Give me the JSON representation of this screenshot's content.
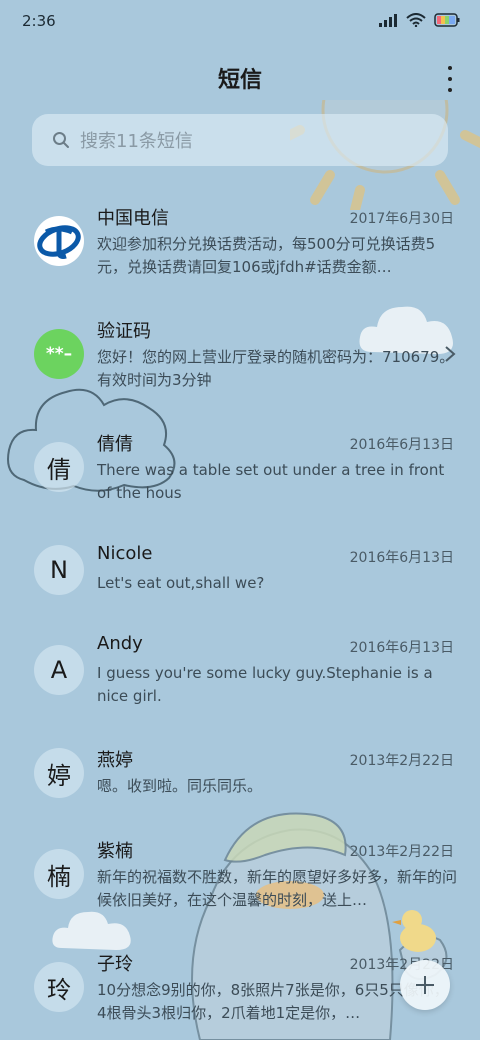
{
  "status": {
    "time": "2:36",
    "icons": [
      "signal-icon",
      "wifi-icon",
      "battery-icon"
    ]
  },
  "header": {
    "title": "短信",
    "menu_icon": "more-vertical-icon"
  },
  "search": {
    "placeholder": "搜索11条短信",
    "icon": "search-icon"
  },
  "messages": [
    {
      "avatar": "",
      "avatar_type": "china-telecom-logo",
      "sender": "中国电信",
      "date": "2017年6月30日",
      "preview": "欢迎参加积分兑换话费活动，每500分可兑换话费5元，兑换话费请回复106或jfdh#话费金额…"
    },
    {
      "avatar": "**–",
      "avatar_type": "code",
      "sender": "验证码",
      "date": "",
      "preview": "您好！您的网上营业厅登录的随机密码为：710679。有效时间为3分钟"
    },
    {
      "avatar": "倩",
      "sender": "倩倩",
      "date": "2016年6月13日",
      "preview": "There was a table set out under a tree in front of the hous"
    },
    {
      "avatar": "N",
      "sender": "Nicole",
      "date": "2016年6月13日",
      "preview": "Let's eat out,shall we?"
    },
    {
      "avatar": "A",
      "sender": "Andy",
      "date": "2016年6月13日",
      "preview": "I guess you're some lucky guy.Stephanie is a nice girl."
    },
    {
      "avatar": "婷",
      "sender": "燕婷",
      "date": "2013年2月22日",
      "preview": "嗯。收到啦。同乐同乐。"
    },
    {
      "avatar": "楠",
      "sender": "紫楠",
      "date": "2013年2月22日",
      "preview": "新年的祝福数不胜数，新年的愿望好多好多，新年的问候依旧美好，在这个温馨的时刻，送上…"
    },
    {
      "avatar": "玲",
      "sender": "子玲",
      "date": "2013年2月22日",
      "preview": "10分想念9别的你，8张照片7张是你，6只5只像你，4根骨头3根归你，2爪着地1定是你，…"
    }
  ],
  "colors": {
    "background": "#a9c8dc",
    "code_avatar": "#6cd35f",
    "telecom_blue": "#0b59a8"
  },
  "fab": {
    "icon": "plus-icon"
  }
}
